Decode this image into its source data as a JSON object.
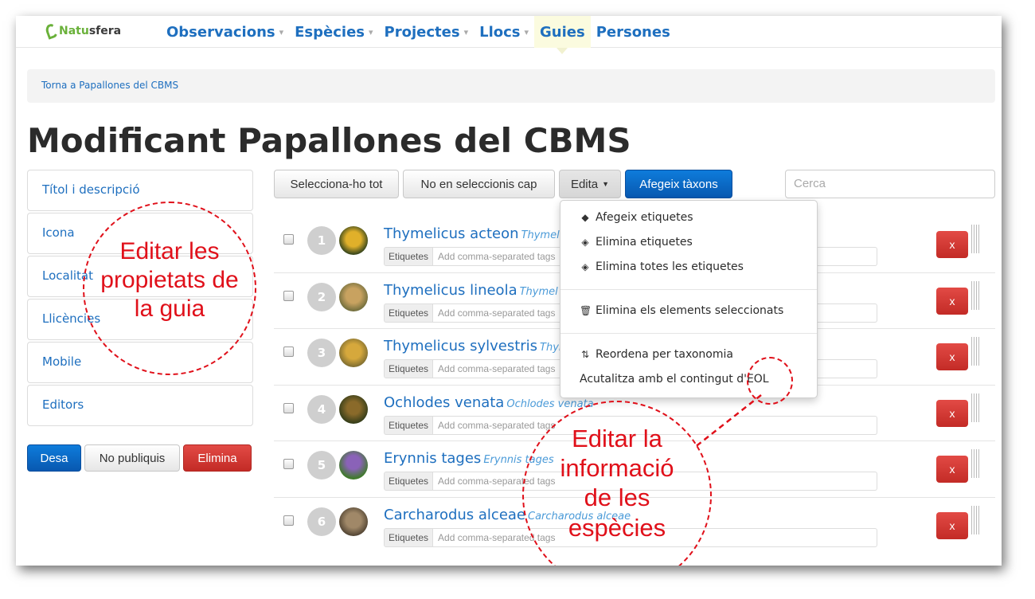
{
  "logo": {
    "text_green": "Natu",
    "text_dark": "sfera"
  },
  "nav": {
    "items": [
      {
        "label": "Observacions",
        "caret": "▾"
      },
      {
        "label": "Espècies",
        "caret": "▾"
      },
      {
        "label": "Projectes",
        "caret": "▾"
      },
      {
        "label": "Llocs",
        "caret": "▾"
      },
      {
        "label": "Guies",
        "caret": ""
      },
      {
        "label": "Persones",
        "caret": ""
      }
    ],
    "active": "Guies"
  },
  "breadcrumb": "Torna a Papallones del CBMS",
  "page_title": "Modificant Papallones del CBMS",
  "sidebar": {
    "items": [
      {
        "label": "Títol i descripció"
      },
      {
        "label": "Icona"
      },
      {
        "label": "Localitat"
      },
      {
        "label": "Llicències"
      },
      {
        "label": "Mobile"
      },
      {
        "label": "Editors"
      }
    ],
    "save_label": "Desa",
    "unpublish_label": "No publiquis",
    "delete_label": "Elimina"
  },
  "toolbar": {
    "select_all": "Selecciona-ho tot",
    "select_none": "No en seleccionis cap",
    "edit": "Edita",
    "add_taxa": "Afegeix tàxons",
    "search_placeholder": "Cerca"
  },
  "dropdown": {
    "items": [
      {
        "label": "Afegeix etiquetes",
        "icon": "tag-icon"
      },
      {
        "label": "Elimina etiquetes",
        "icon": "tag-remove-icon"
      },
      {
        "label": "Elimina totes les etiquetes",
        "icon": "tag-remove-all-icon"
      },
      {
        "label": "Elimina els elements seleccionats",
        "icon": "trash-icon"
      },
      {
        "label": "Reordena per taxonomia",
        "icon": "sort-icon"
      },
      {
        "label": "Acutalitza amb el contingut d'EOL",
        "icon": ""
      }
    ]
  },
  "rows": [
    {
      "num": "1",
      "name": "Thymelicus acteon",
      "sci": "Thymel",
      "thumb_color": "#c79a22"
    },
    {
      "num": "2",
      "name": "Thymelicus lineola",
      "sci": "Thymel",
      "thumb_color": "#a98b55"
    },
    {
      "num": "3",
      "name": "Thymelicus sylvestris",
      "sci": "Thym",
      "thumb_color": "#b89338"
    },
    {
      "num": "4",
      "name": "Ochlodes venata",
      "sci": "Ochlodes venata",
      "thumb_color": "#4c4a2c"
    },
    {
      "num": "5",
      "name": "Erynnis tages",
      "sci": "Erynnis tages",
      "thumb_color": "#7a5a9a"
    },
    {
      "num": "6",
      "name": "Carcharodus alceae",
      "sci": "Carcharodus alceae",
      "thumb_color": "#7b6a52"
    }
  ],
  "row_common": {
    "tags_label": "Etiquetes",
    "tags_placeholder": "Add comma-separated tags",
    "delete_label": "x"
  },
  "annotations": {
    "left_lines": [
      "Editar les",
      "propietats de",
      "la guia"
    ],
    "right_lines": [
      "Editar la",
      "informació",
      "de les",
      "espècies"
    ]
  },
  "colors": {
    "link": "#1e6fbf",
    "primary": "#0a6ad0",
    "danger": "#d0352f",
    "annotation": "#e0101a"
  }
}
